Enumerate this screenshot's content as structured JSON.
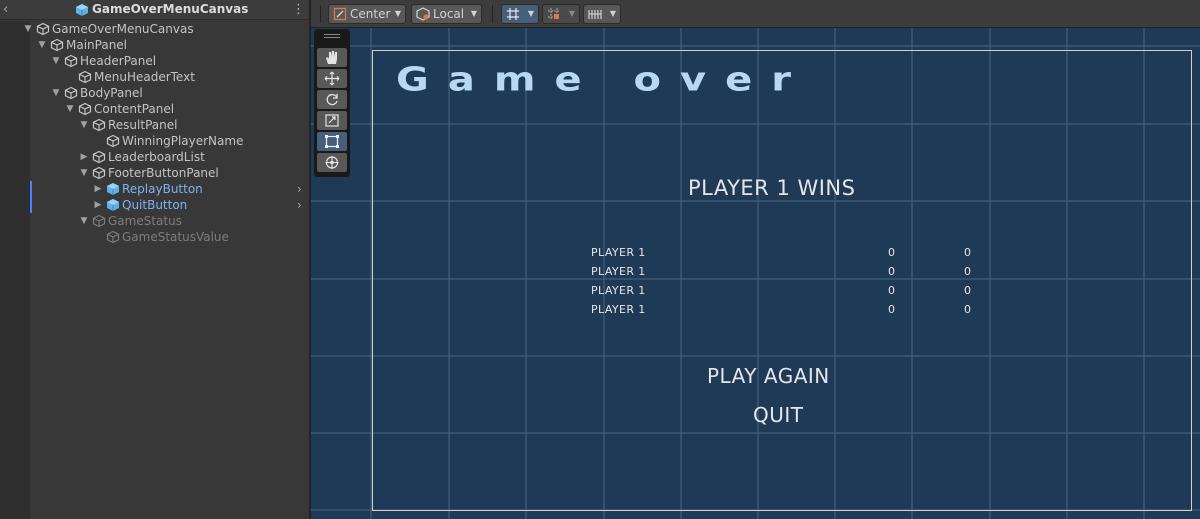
{
  "hierarchy": {
    "scene_title": "GameOverMenuCanvas",
    "items": [
      {
        "label": "GameOverMenuCanvas",
        "depth": 1,
        "foldout": "open",
        "type": "normal"
      },
      {
        "label": "MainPanel",
        "depth": 2,
        "foldout": "open",
        "type": "normal"
      },
      {
        "label": "HeaderPanel",
        "depth": 3,
        "foldout": "open",
        "type": "normal"
      },
      {
        "label": "MenuHeaderText",
        "depth": 4,
        "foldout": "none",
        "type": "normal"
      },
      {
        "label": "BodyPanel",
        "depth": 3,
        "foldout": "open",
        "type": "normal"
      },
      {
        "label": "ContentPanel",
        "depth": 4,
        "foldout": "open",
        "type": "normal"
      },
      {
        "label": "ResultPanel",
        "depth": 5,
        "foldout": "open",
        "type": "normal"
      },
      {
        "label": "WinningPlayerName",
        "depth": 6,
        "foldout": "none",
        "type": "normal"
      },
      {
        "label": "LeaderboardList",
        "depth": 5,
        "foldout": "closed",
        "type": "normal"
      },
      {
        "label": "FooterButtonPanel",
        "depth": 5,
        "foldout": "open",
        "type": "normal"
      },
      {
        "label": "ReplayButton",
        "depth": 6,
        "foldout": "closed",
        "type": "prefab"
      },
      {
        "label": "QuitButton",
        "depth": 6,
        "foldout": "closed",
        "type": "prefab"
      },
      {
        "label": "GameStatus",
        "depth": 5,
        "foldout": "open",
        "type": "inactive"
      },
      {
        "label": "GameStatusValue",
        "depth": 6,
        "foldout": "none",
        "type": "inactive"
      }
    ]
  },
  "toolbar": {
    "pivot_label": "Center",
    "space_label": "Local"
  },
  "game_ui": {
    "title": "Game over",
    "winner_text": "PLAYER 1 WINS",
    "leaderboard": [
      {
        "name": "PLAYER 1",
        "score_a": "0",
        "score_b": "0"
      },
      {
        "name": "PLAYER 1",
        "score_a": "0",
        "score_b": "0"
      },
      {
        "name": "PLAYER 1",
        "score_a": "0",
        "score_b": "0"
      },
      {
        "name": "PLAYER 1",
        "score_a": "0",
        "score_b": "0"
      }
    ],
    "play_again_label": "PLAY AGAIN",
    "quit_label": "QUIT"
  },
  "colors": {
    "viewport_bg": "#1f3a56",
    "grid_line": "#4b6580",
    "prefab_text": "#7cb2f2",
    "title_text": "#b8d8f2",
    "selection_mark": "#4c7fff"
  }
}
